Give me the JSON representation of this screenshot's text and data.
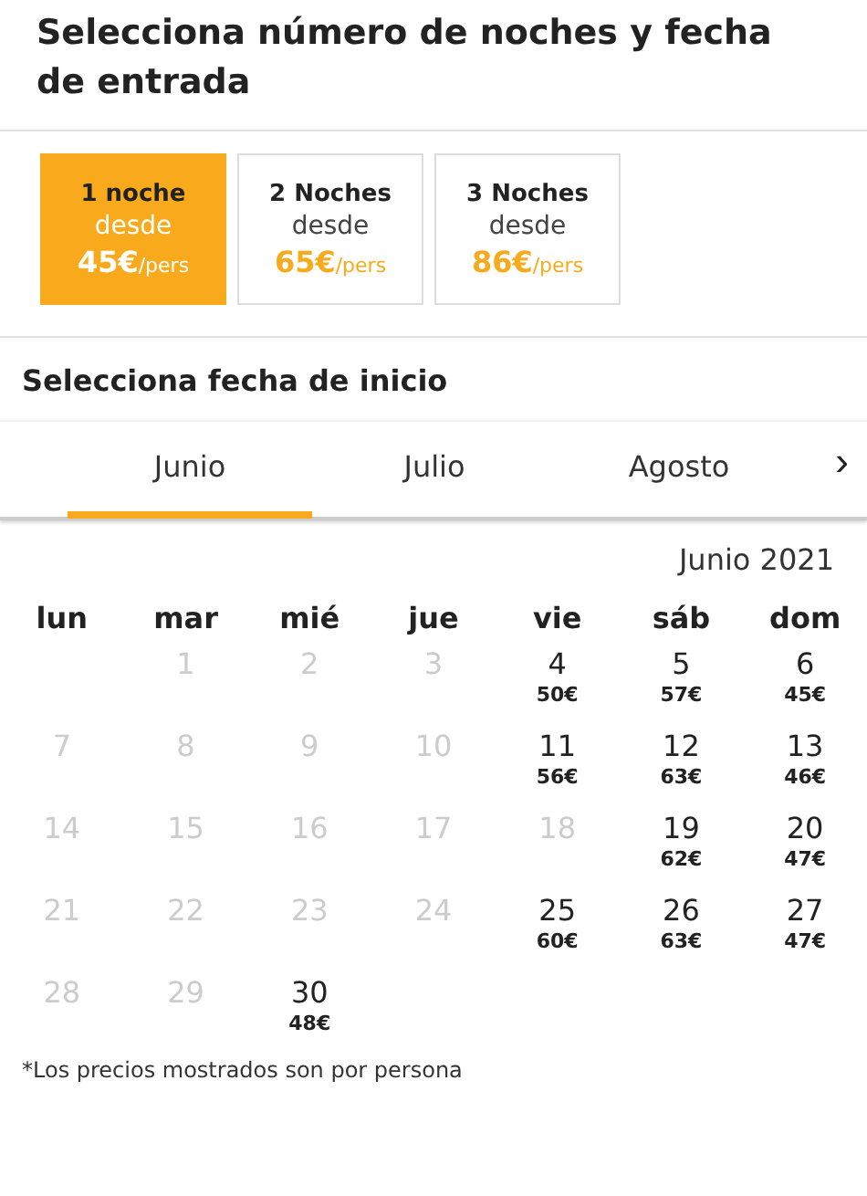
{
  "header": {
    "title": "Selecciona número de noches y fecha de entrada"
  },
  "night_options": [
    {
      "label": "1 noche",
      "from": "desde",
      "price": "45€",
      "unit": "/pers",
      "selected": true
    },
    {
      "label": "2 Noches",
      "from": "desde",
      "price": "65€",
      "unit": "/pers",
      "selected": false
    },
    {
      "label": "3 Noches",
      "from": "desde",
      "price": "86€",
      "unit": "/pers",
      "selected": false
    }
  ],
  "date_section": {
    "title": "Selecciona fecha de inicio"
  },
  "month_tabs": [
    {
      "label": "Junio",
      "selected": true
    },
    {
      "label": "Julio",
      "selected": false
    },
    {
      "label": "Agosto",
      "selected": false
    }
  ],
  "next_button": {
    "label": "›"
  },
  "calendar": {
    "month_label": "Junio 2021",
    "weekdays": [
      "lun",
      "mar",
      "mié",
      "jue",
      "vie",
      "sáb",
      "dom"
    ],
    "weeks": [
      [
        {
          "kind": "empty"
        },
        {
          "kind": "day",
          "day": "1",
          "disabled": true
        },
        {
          "kind": "day",
          "day": "2",
          "disabled": true
        },
        {
          "kind": "day",
          "day": "3",
          "disabled": true
        },
        {
          "kind": "day",
          "day": "4",
          "disabled": false,
          "price": "50€"
        },
        {
          "kind": "day",
          "day": "5",
          "disabled": false,
          "price": "57€"
        },
        {
          "kind": "day",
          "day": "6",
          "disabled": false,
          "price": "45€"
        }
      ],
      [
        {
          "kind": "day",
          "day": "7",
          "disabled": true
        },
        {
          "kind": "day",
          "day": "8",
          "disabled": true
        },
        {
          "kind": "day",
          "day": "9",
          "disabled": true
        },
        {
          "kind": "day",
          "day": "10",
          "disabled": true
        },
        {
          "kind": "day",
          "day": "11",
          "disabled": false,
          "price": "56€"
        },
        {
          "kind": "day",
          "day": "12",
          "disabled": false,
          "price": "63€"
        },
        {
          "kind": "day",
          "day": "13",
          "disabled": false,
          "price": "46€"
        }
      ],
      [
        {
          "kind": "day",
          "day": "14",
          "disabled": true
        },
        {
          "kind": "day",
          "day": "15",
          "disabled": true
        },
        {
          "kind": "day",
          "day": "16",
          "disabled": true
        },
        {
          "kind": "day",
          "day": "17",
          "disabled": true
        },
        {
          "kind": "day",
          "day": "18",
          "disabled": true
        },
        {
          "kind": "day",
          "day": "19",
          "disabled": false,
          "price": "62€"
        },
        {
          "kind": "day",
          "day": "20",
          "disabled": false,
          "price": "47€"
        }
      ],
      [
        {
          "kind": "day",
          "day": "21",
          "disabled": true
        },
        {
          "kind": "day",
          "day": "22",
          "disabled": true
        },
        {
          "kind": "day",
          "day": "23",
          "disabled": true
        },
        {
          "kind": "day",
          "day": "24",
          "disabled": true
        },
        {
          "kind": "day",
          "day": "25",
          "disabled": false,
          "price": "60€"
        },
        {
          "kind": "day",
          "day": "26",
          "disabled": false,
          "price": "63€"
        },
        {
          "kind": "day",
          "day": "27",
          "disabled": false,
          "price": "47€"
        }
      ],
      [
        {
          "kind": "day",
          "day": "28",
          "disabled": true
        },
        {
          "kind": "day",
          "day": "29",
          "disabled": true
        },
        {
          "kind": "day",
          "day": "30",
          "disabled": false,
          "price": "48€"
        }
      ]
    ]
  },
  "footnote": "*Los precios mostrados son por persona"
}
